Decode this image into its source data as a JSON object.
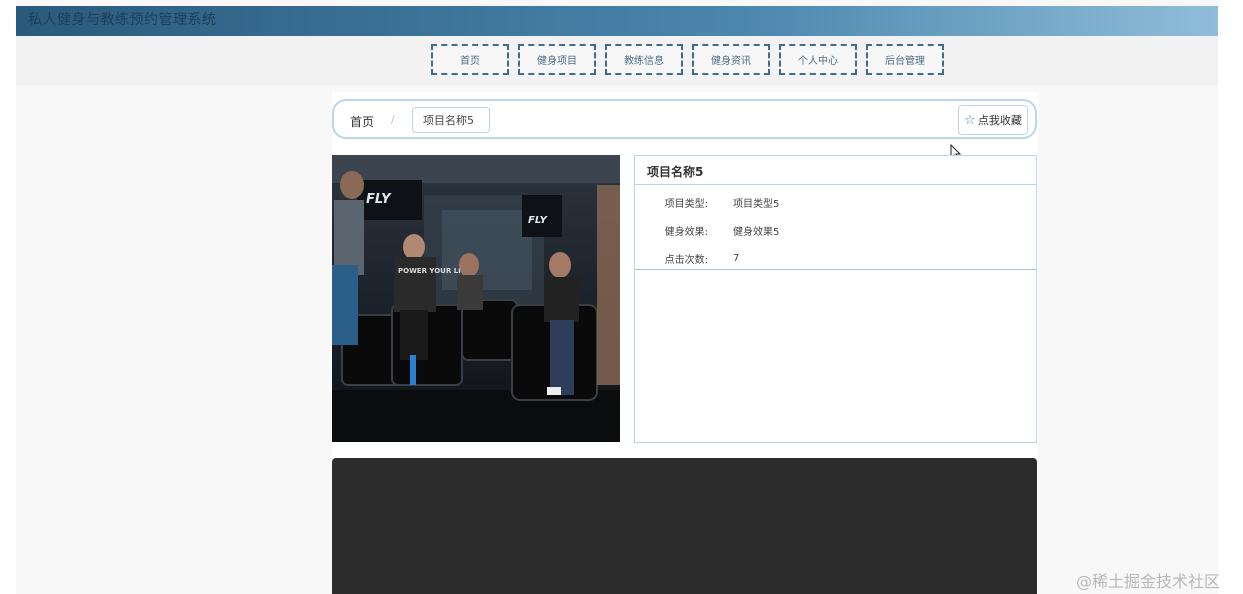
{
  "header": {
    "site_title": "私人健身与教练预约管理系统"
  },
  "nav": {
    "items": [
      {
        "label": "首页"
      },
      {
        "label": "健身项目"
      },
      {
        "label": "教练信息"
      },
      {
        "label": "健身资讯"
      },
      {
        "label": "个人中心"
      },
      {
        "label": "后台管理"
      }
    ]
  },
  "breadcrumb": {
    "home": "首页",
    "separator": "/",
    "current": "项目名称5"
  },
  "favorite_button": {
    "label": "点我收藏",
    "icon": "star-icon"
  },
  "detail": {
    "title": "项目名称5",
    "rows": [
      {
        "label": "项目类型:",
        "value": "项目类型5"
      },
      {
        "label": "健身效果:",
        "value": "健身效果5"
      },
      {
        "label": "点击次数:",
        "value": "7"
      }
    ]
  },
  "image": {
    "overlay_texts": [
      "FLY",
      "FLY",
      "POWER YOUR LIFE"
    ]
  },
  "watermark": "@稀土掘金技术社区",
  "colors": {
    "accent": "#b9d6ea",
    "nav_border": "#3f6a92",
    "header_start": "#2a5a7c",
    "header_end": "#8fbdd9"
  }
}
